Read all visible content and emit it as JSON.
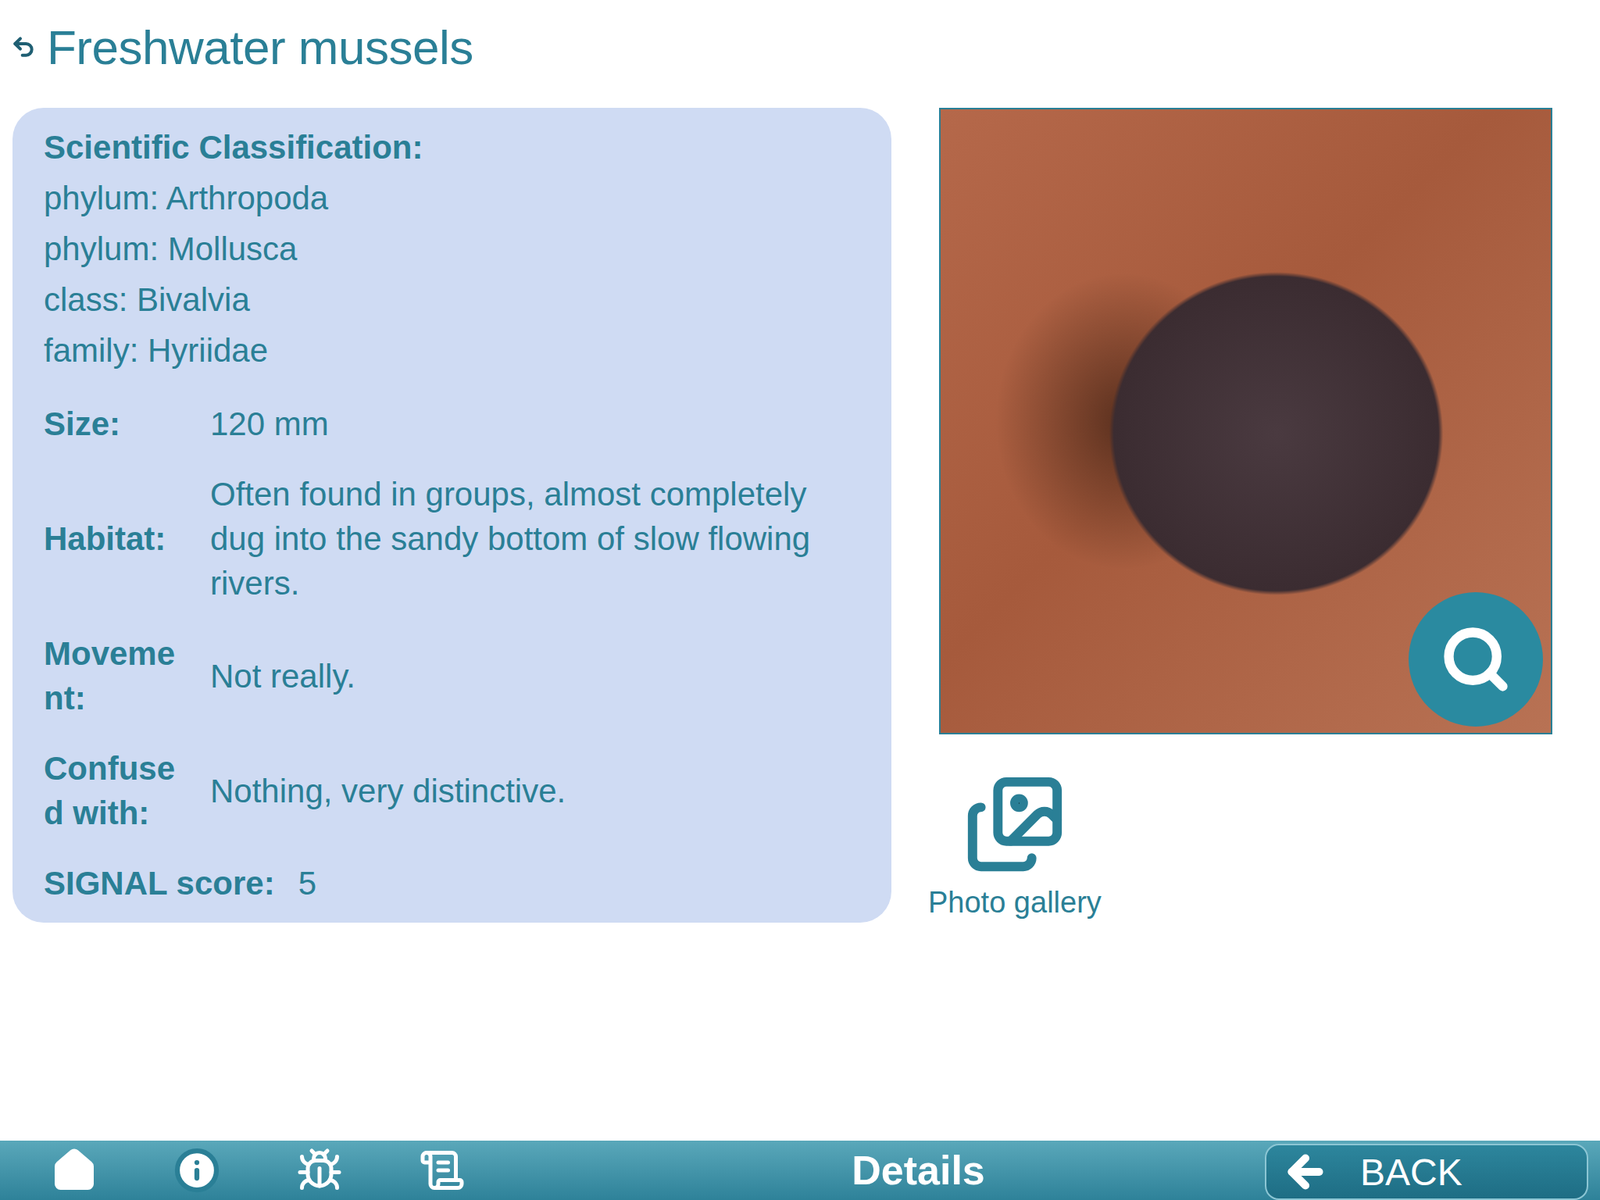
{
  "title": "Freshwater mussels",
  "classification": {
    "heading": "Scientific Classification:",
    "lines": [
      "phylum: Arthropoda",
      "phylum: Mollusca",
      "class: Bivalvia",
      "family: Hyriidae"
    ]
  },
  "details": [
    {
      "label": "Size:",
      "value": "120 mm",
      "kind": "column"
    },
    {
      "label": "Habitat:",
      "value": "Often found in groups, almost completely dug into the sandy bottom of slow flowing rivers.",
      "kind": "column"
    },
    {
      "label": "Movement:",
      "value": "Not really.",
      "kind": "column"
    },
    {
      "label": "Confused with:",
      "value": "Nothing, very distinctive.",
      "kind": "column"
    },
    {
      "label": "SIGNAL score:",
      "value": "5",
      "kind": "inline"
    }
  ],
  "gallery": {
    "label": "Photo gallery"
  },
  "toolbar": {
    "title": "Details",
    "back_button": "BACK"
  }
}
